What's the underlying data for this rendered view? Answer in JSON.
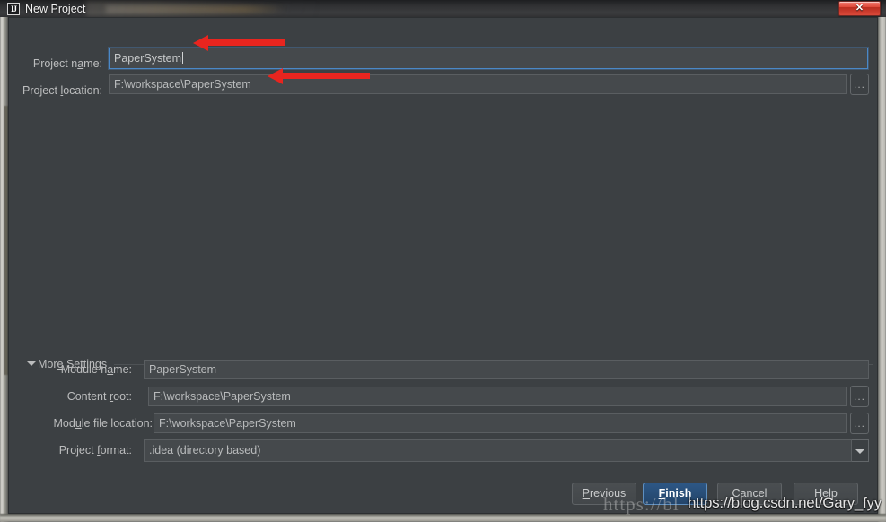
{
  "window": {
    "title": "New Project",
    "app_icon": "IJ",
    "close_icon": "✕",
    "close_label": "Close"
  },
  "form": {
    "project_name": {
      "label_pre": "Project n",
      "label_mnemonic": "a",
      "label_post": "me:",
      "value": "PaperSystem"
    },
    "project_location": {
      "label_pre": "Project ",
      "label_mnemonic": "l",
      "label_post": "ocation:",
      "value": "F:\\workspace\\PaperSystem",
      "browse_label": "..."
    }
  },
  "more_settings": {
    "label_pre": "Mor",
    "label_mnemonic": "e",
    "label_post": " Settings",
    "expanded": true,
    "rows": [
      {
        "label_pre": "Module n",
        "label_mnemonic": "a",
        "label_post": "me:",
        "value": "PaperSystem",
        "has_browse": false,
        "kind": "text"
      },
      {
        "label_pre": "Content ",
        "label_mnemonic": "r",
        "label_post": "oot:",
        "value": "F:\\workspace\\PaperSystem",
        "has_browse": true,
        "browse_label": "...",
        "kind": "text"
      },
      {
        "label_pre": "Mod",
        "label_mnemonic": "u",
        "label_post": "le file location:",
        "value": "F:\\workspace\\PaperSystem",
        "has_browse": true,
        "browse_label": "...",
        "kind": "text"
      },
      {
        "label_pre": "Project ",
        "label_mnemonic": "f",
        "label_post": "ormat:",
        "value": ".idea (directory based)",
        "has_browse": false,
        "kind": "dropdown",
        "options": [
          ".idea (directory based)"
        ]
      }
    ]
  },
  "buttons": {
    "previous": {
      "pre": "",
      "mnemonic": "P",
      "post": "revious",
      "default": false
    },
    "finish": {
      "pre": "",
      "mnemonic": "F",
      "post": "inish",
      "default": true
    },
    "cancel": {
      "pre": "Cancel",
      "mnemonic": "",
      "post": "",
      "default": false
    },
    "help": {
      "pre": "Help",
      "mnemonic": "",
      "post": "",
      "default": false
    }
  },
  "annotations": {
    "arrow_name_field": "points to project name field",
    "arrow_location_field": "points to project location field",
    "arrow_color": "#e8251f"
  },
  "watermarks": {
    "background": "https://bl",
    "foreground": "https://blog.csdn.net/Gary_fyy"
  },
  "colors": {
    "dialog_bg": "#3c4043",
    "field_bg": "#45494c",
    "field_border": "#5a5e61",
    "focus_border": "#4a88c7",
    "text": "#bcbdbe",
    "default_button": "#2d5785",
    "close_button": "#e24b3c"
  }
}
